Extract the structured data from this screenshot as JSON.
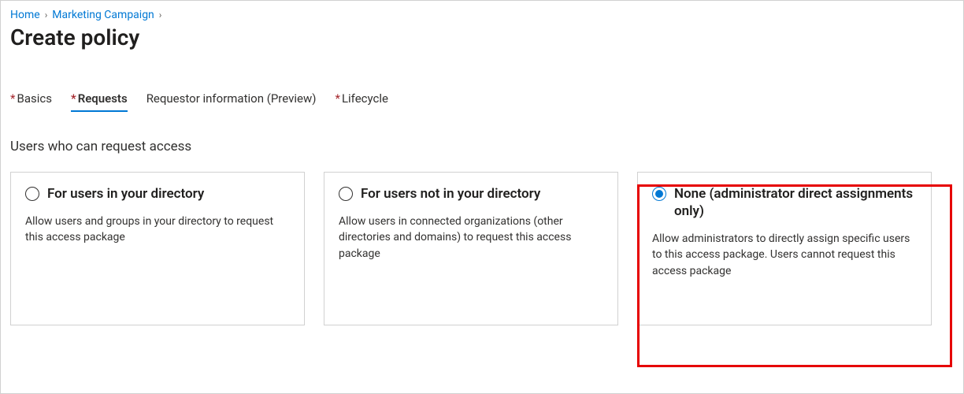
{
  "breadcrumb": {
    "home": "Home",
    "campaign": "Marketing Campaign"
  },
  "page_title": "Create policy",
  "tabs": {
    "basics": "Basics",
    "requests": "Requests",
    "requestor_info": "Requestor information (Preview)",
    "lifecycle": "Lifecycle"
  },
  "section_title": "Users who can request access",
  "cards": {
    "in_directory": {
      "title": "For users in your directory",
      "desc": "Allow users and groups in your directory to request this access package"
    },
    "not_in_directory": {
      "title": "For users not in your directory",
      "desc": "Allow users in connected organizations (other directories and domains) to request this access package"
    },
    "none": {
      "title": "None (administrator direct assignments only)",
      "desc": "Allow administrators to directly assign specific users to this access package. Users cannot request this access package"
    }
  }
}
